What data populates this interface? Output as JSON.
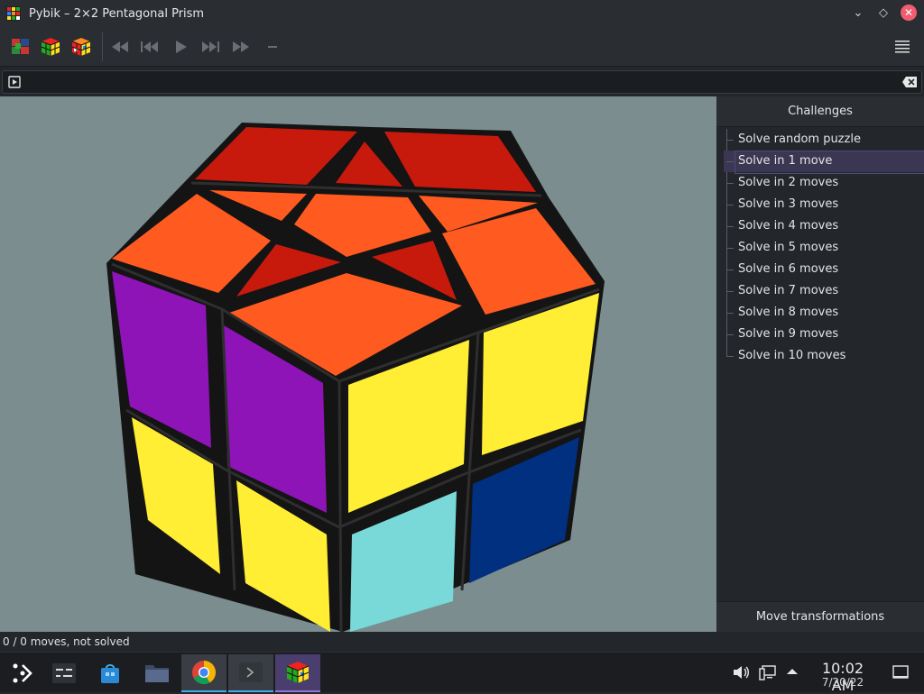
{
  "window": {
    "title": "Pybik – 2×2 Pentagonal Prism",
    "minimize_glyph": "⌄",
    "maximize_glyph": "◇",
    "close_glyph": "✕"
  },
  "toolbar": {
    "items": [
      {
        "name": "new-random-puzzle-icon"
      },
      {
        "name": "new-solved-puzzle-icon"
      },
      {
        "name": "select-puzzle-icon"
      },
      {
        "name": "rewind-icon"
      },
      {
        "name": "previous-icon"
      },
      {
        "name": "play-icon"
      },
      {
        "name": "next-icon"
      },
      {
        "name": "forward-icon"
      },
      {
        "name": "mark-icon"
      },
      {
        "name": "menu-icon"
      }
    ]
  },
  "command": {
    "value": "",
    "placeholder": ""
  },
  "sidebar": {
    "challenges_title": "Challenges",
    "challenges": [
      {
        "label": "Solve random puzzle",
        "selected": false
      },
      {
        "label": "Solve in 1 move",
        "selected": true
      },
      {
        "label": "Solve in 2 moves",
        "selected": false
      },
      {
        "label": "Solve in 3 moves",
        "selected": false
      },
      {
        "label": "Solve in 4 moves",
        "selected": false
      },
      {
        "label": "Solve in 5 moves",
        "selected": false
      },
      {
        "label": "Solve in 6 moves",
        "selected": false
      },
      {
        "label": "Solve in 7 moves",
        "selected": false
      },
      {
        "label": "Solve in 8 moves",
        "selected": false
      },
      {
        "label": "Solve in 9 moves",
        "selected": false
      },
      {
        "label": "Solve in 10 moves",
        "selected": false
      }
    ],
    "move_transformations_title": "Move transformations"
  },
  "status": {
    "text": "0 / 0 moves, not solved"
  },
  "taskbar": {
    "clock_time": "10:02 AM",
    "clock_date": "7/20/22"
  },
  "colors": {
    "viewport_bg": "#7b8d8e",
    "selection": "#3b3752",
    "accent": "#3daee9",
    "red": "#c8190d",
    "orange": "#ff5a1f",
    "purple": "#8e14b8",
    "yellow": "#ffee33",
    "cyan": "#79d8d8",
    "blue": "#00307f"
  }
}
